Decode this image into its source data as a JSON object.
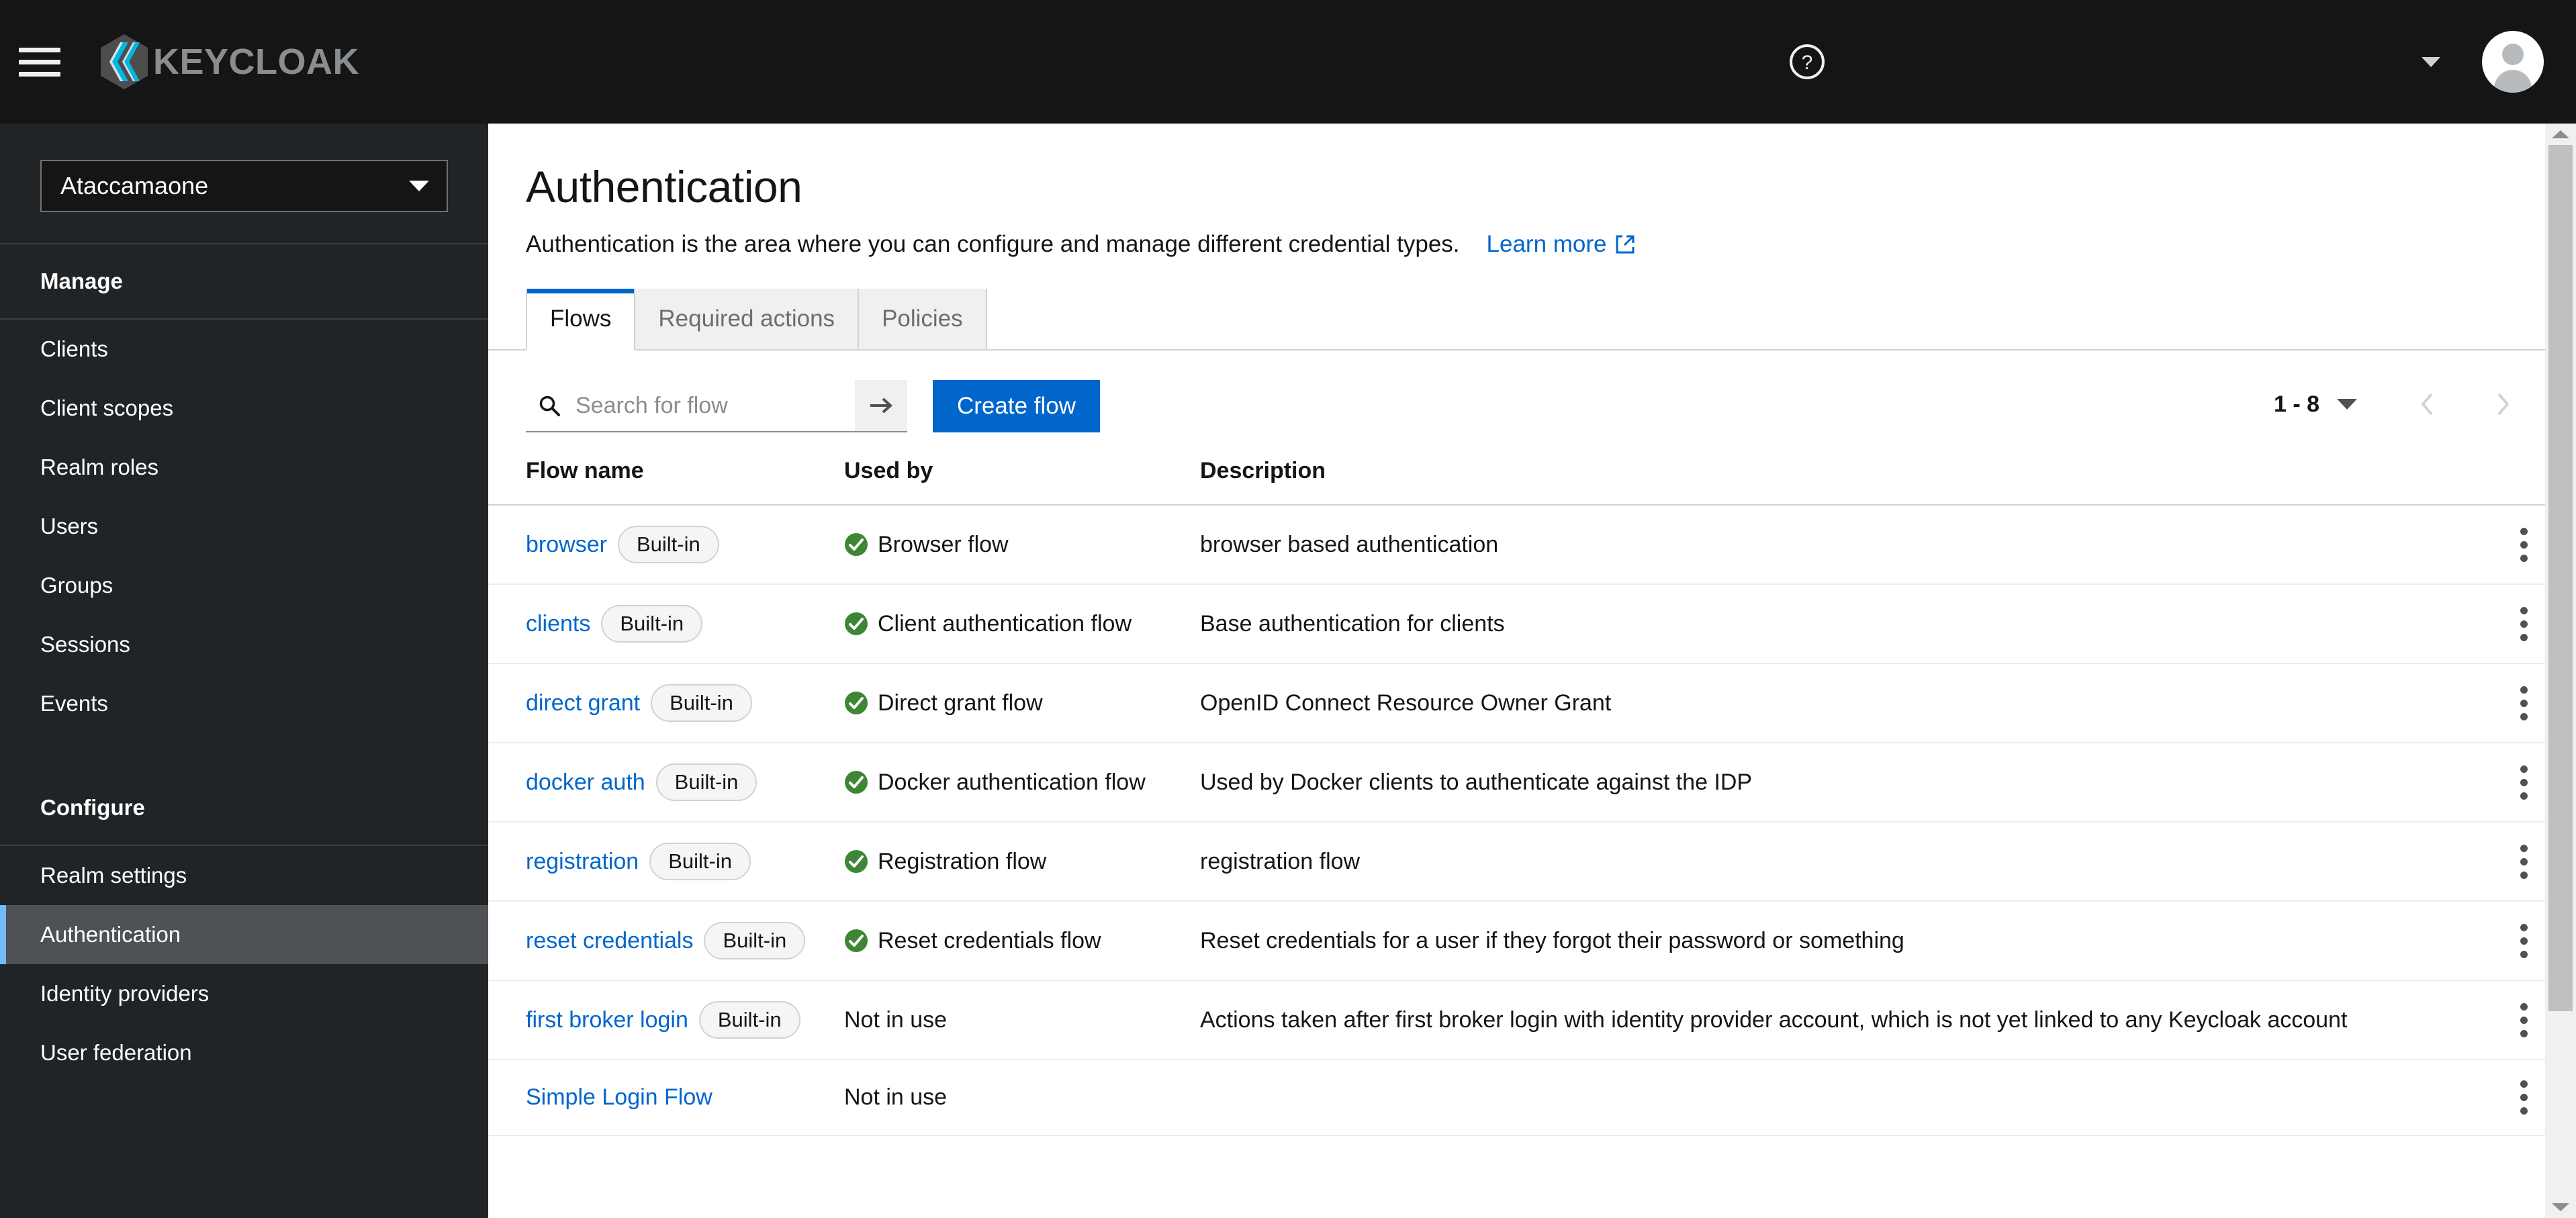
{
  "masthead": {
    "menu_toggle": "global-navigation-toggle",
    "brand_text": "KEYCLOAK",
    "help_icon": "help-circle-icon",
    "user_caret": "chevron-down-icon",
    "avatar": "user-avatar"
  },
  "sidebar": {
    "realm": {
      "name": "Ataccamaone"
    },
    "groups": [
      {
        "title": "Manage",
        "items": [
          {
            "label": "Clients",
            "active": false
          },
          {
            "label": "Client scopes",
            "active": false
          },
          {
            "label": "Realm roles",
            "active": false
          },
          {
            "label": "Users",
            "active": false
          },
          {
            "label": "Groups",
            "active": false
          },
          {
            "label": "Sessions",
            "active": false
          },
          {
            "label": "Events",
            "active": false
          }
        ]
      },
      {
        "title": "Configure",
        "items": [
          {
            "label": "Realm settings",
            "active": false
          },
          {
            "label": "Authentication",
            "active": true
          },
          {
            "label": "Identity providers",
            "active": false
          },
          {
            "label": "User federation",
            "active": false
          }
        ]
      }
    ]
  },
  "page": {
    "title": "Authentication",
    "description": "Authentication is the area where you can configure and manage different credential types.",
    "learn_more": "Learn more"
  },
  "tabs": [
    {
      "label": "Flows",
      "active": true
    },
    {
      "label": "Required actions",
      "active": false
    },
    {
      "label": "Policies",
      "active": false
    }
  ],
  "toolbar": {
    "search_placeholder": "Search for flow",
    "search_value": "",
    "search_submit_icon": "arrow-right-icon",
    "create_label": "Create flow"
  },
  "pagination": {
    "range": "1 - 8",
    "prev_icon": "chevron-left-icon",
    "next_icon": "chevron-right-icon"
  },
  "table": {
    "columns": [
      "Flow name",
      "Used by",
      "Description"
    ],
    "rows": [
      {
        "name": "browser",
        "builtin": "Built-in",
        "used_by": "Browser flow",
        "in_use": true,
        "description": "browser based authentication"
      },
      {
        "name": "clients",
        "builtin": "Built-in",
        "used_by": "Client authentication flow",
        "in_use": true,
        "description": "Base authentication for clients"
      },
      {
        "name": "direct grant",
        "builtin": "Built-in",
        "used_by": "Direct grant flow",
        "in_use": true,
        "description": "OpenID Connect Resource Owner Grant"
      },
      {
        "name": "docker auth",
        "builtin": "Built-in",
        "used_by": "Docker authentication flow",
        "in_use": true,
        "description": "Used by Docker clients to authenticate against the IDP"
      },
      {
        "name": "registration",
        "builtin": "Built-in",
        "used_by": "Registration flow",
        "in_use": true,
        "description": "registration flow"
      },
      {
        "name": "reset credentials",
        "builtin": "Built-in",
        "used_by": "Reset credentials flow",
        "in_use": true,
        "description": "Reset credentials for a user if they forgot their password or something"
      },
      {
        "name": "first broker login",
        "builtin": "Built-in",
        "used_by": "Not in use",
        "in_use": false,
        "description": "Actions taken after first broker login with identity provider account, which is not yet linked to any Keycloak account"
      },
      {
        "name": "Simple Login Flow",
        "builtin": "",
        "used_by": "Not in use",
        "in_use": false,
        "description": ""
      }
    ],
    "row_menu_icon": "kebab-menu-icon"
  },
  "colors": {
    "accent_blue": "#0066cc",
    "link_blue": "#06c",
    "success_green": "#3e8635",
    "masthead_bg": "#151515",
    "sidebar_bg": "#212427",
    "active_nav_bg": "#4f5255",
    "active_nav_marker": "#73bcf7"
  }
}
